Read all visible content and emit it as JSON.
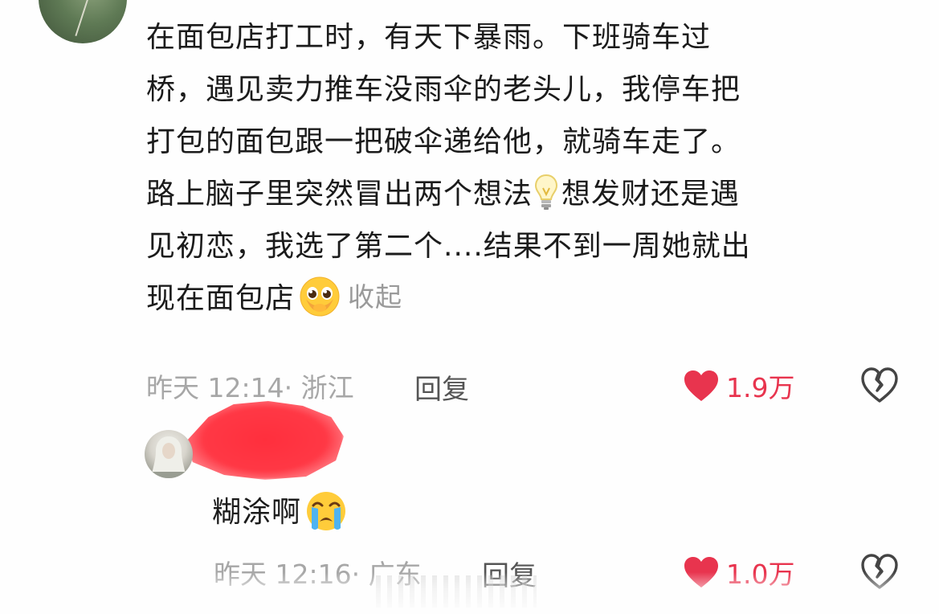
{
  "comment": {
    "lines": [
      "在面包店打工时，有天下暴雨。下班骑车过",
      "桥，遇见卖力推车没雨伞的老头儿，我停车把",
      "打包的面包跟一把破伞递给他，就骑车走了。",
      "路上脑子里突然冒出两个想法",
      "想发财还是遇",
      "见初恋，我选了第二个....结果不到一周她就出",
      "现在面包店"
    ],
    "collapse_label": "收起",
    "time": "昨天 12:14",
    "location": "· 浙江",
    "reply_label": "回复",
    "likes": "1.9万"
  },
  "reply": {
    "text": "糊涂啊",
    "time": "昨天 12:16",
    "location": "· 广东",
    "reply_label": "回复",
    "likes": "1.0万"
  },
  "colors": {
    "like_red": "#e8344e",
    "meta_gray": "#a7a7a7",
    "text": "#1b1b1b"
  },
  "icons": [
    "lightbulb-emoji",
    "pleading-face-emoji",
    "heart-icon",
    "broken-heart-icon",
    "loudly-crying-face-emoji"
  ]
}
